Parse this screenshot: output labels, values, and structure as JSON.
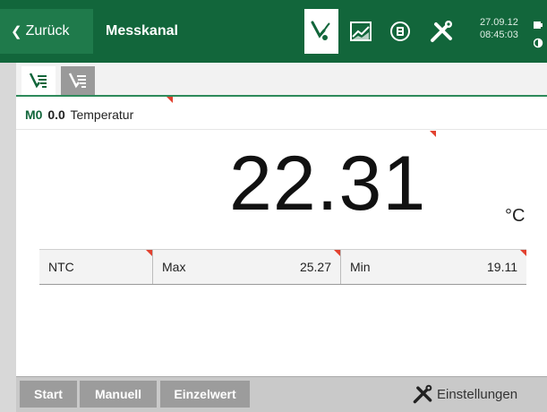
{
  "header": {
    "back_label": "Zurück",
    "back_icon": "chevron-left-icon",
    "title": "Messkanal",
    "icons": [
      "probe-icon",
      "line-chart-icon",
      "storage-icon",
      "tools-icon"
    ],
    "date": "27.09.12",
    "time": "08:45:03"
  },
  "tabs": [
    {
      "icon": "channel-list-icon",
      "active": true
    },
    {
      "icon": "channel-list-multi-icon",
      "active": false
    }
  ],
  "channel": {
    "id": "M0",
    "number": "0.0",
    "name": "Temperatur"
  },
  "measurement": {
    "value": "22.31",
    "unit": "°C"
  },
  "info": {
    "sensor": "NTC",
    "max_label": "Max",
    "max_value": "25.27",
    "min_label": "Min",
    "min_value": "19.11"
  },
  "footer": {
    "start": "Start",
    "manual": "Manuell",
    "single": "Einzelwert",
    "settings": "Einstellungen"
  },
  "colors": {
    "brand_green": "#12663b",
    "marker_red": "#e2412f"
  }
}
